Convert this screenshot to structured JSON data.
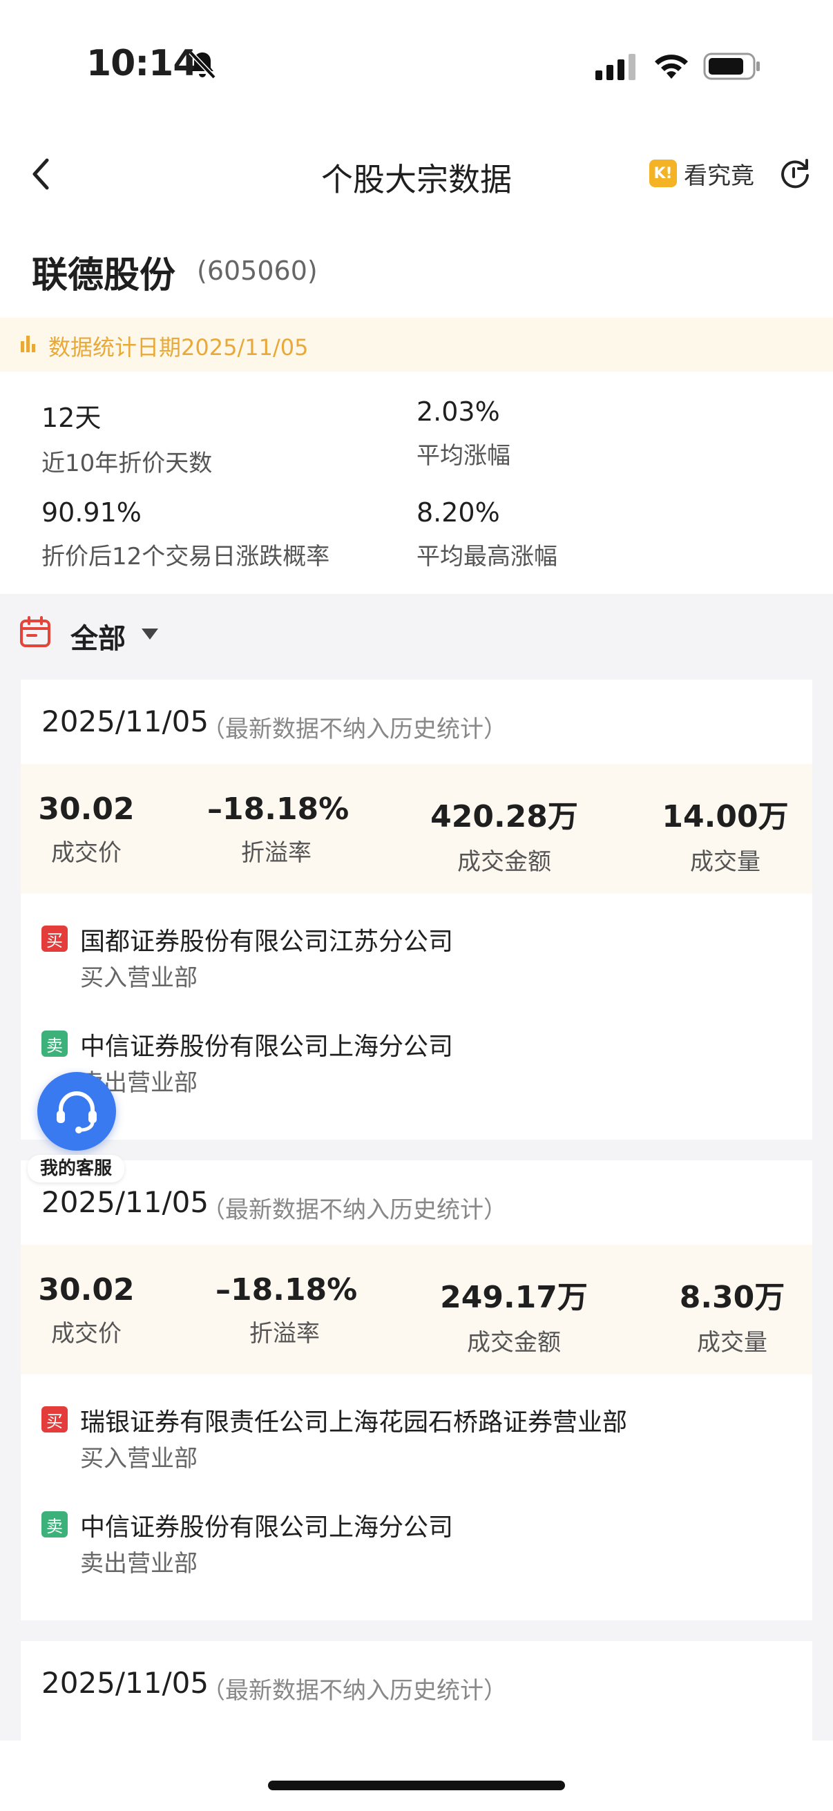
{
  "status_bar": {
    "time": "10:14"
  },
  "nav": {
    "title": "个股大宗数据",
    "insight_label": "看究竟",
    "insight_icon_text": "K!"
  },
  "stock": {
    "name": "联德股份",
    "code": "(605060)"
  },
  "banner": {
    "text": "数据统计日期2025/11/05"
  },
  "stats": [
    {
      "value": "12天",
      "label": "近10年折价天数"
    },
    {
      "value": "2.03%",
      "label": "平均涨幅"
    },
    {
      "value": "90.91%",
      "label": "折价后12个交易日涨跌概率"
    },
    {
      "value": "8.20%",
      "label": "平均最高涨幅"
    }
  ],
  "filter": {
    "label": "全部"
  },
  "metric_labels": {
    "price": "成交价",
    "premium": "折溢率",
    "amount": "成交金额",
    "volume": "成交量"
  },
  "tags": {
    "buy": "买",
    "sell": "卖"
  },
  "roles": {
    "buy": "买入营业部",
    "sell": "卖出营业部"
  },
  "cards": [
    {
      "date": "2025/11/05",
      "note": "（最新数据不纳入历史统计）",
      "price": "30.02",
      "premium": "–18.18%",
      "amount": "420.28万",
      "volume": "14.00万",
      "buyer": "国都证券股份有限公司江苏分公司",
      "seller": "中信证券股份有限公司上海分公司"
    },
    {
      "date": "2025/11/05",
      "note": "（最新数据不纳入历史统计）",
      "price": "30.02",
      "premium": "–18.18%",
      "amount": "249.17万",
      "volume": "8.30万",
      "buyer": "瑞银证券有限责任公司上海花园石桥路证券营业部",
      "seller": "中信证券股份有限公司上海分公司"
    },
    {
      "date": "2025/11/05",
      "note": "（最新数据不纳入历史统计）"
    }
  ],
  "service": {
    "label": "我的客服"
  },
  "colors": {
    "accent_blue": "#3a7af0",
    "buy_red": "#e43b3b",
    "sell_green": "#3cb27a",
    "banner_gold": "#e8a93a"
  }
}
